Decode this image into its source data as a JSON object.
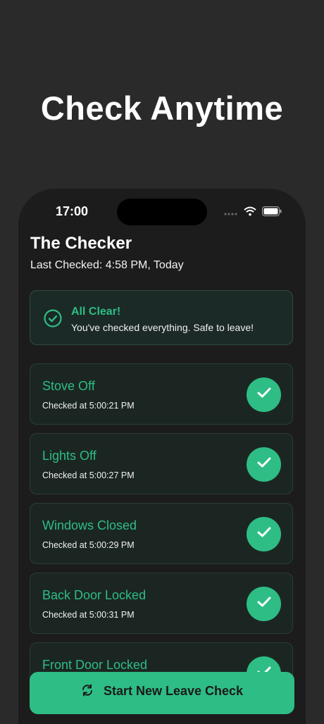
{
  "headline": "Check Anytime",
  "status_bar": {
    "time": "17:00"
  },
  "app": {
    "title": "The Checker",
    "last_checked": "Last Checked: 4:58 PM, Today"
  },
  "banner": {
    "title": "All Clear!",
    "subtitle": "You've checked everything. Safe to leave!",
    "icon": "check-circle-icon"
  },
  "items": [
    {
      "title": "Stove Off",
      "checked_at": "Checked at 5:00:21 PM"
    },
    {
      "title": "Lights Off",
      "checked_at": "Checked at 5:00:27 PM"
    },
    {
      "title": "Windows Closed",
      "checked_at": "Checked at 5:00:29 PM"
    },
    {
      "title": "Back Door Locked",
      "checked_at": "Checked at 5:00:31 PM"
    },
    {
      "title": "Front Door Locked",
      "checked_at": ""
    }
  ],
  "start_button": {
    "label": "Start New Leave Check",
    "icon": "refresh-icon"
  },
  "colors": {
    "accent": "#2ebd85",
    "background": "#2a2a2a",
    "phone": "#1c1c1c"
  }
}
